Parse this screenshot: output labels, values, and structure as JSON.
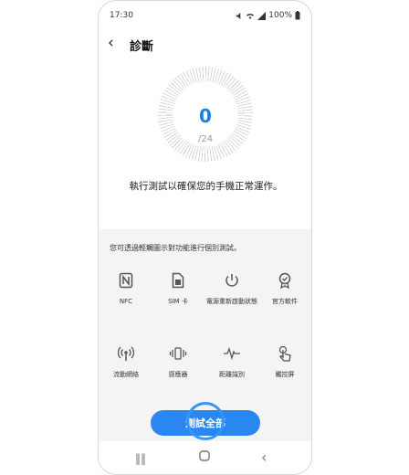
{
  "status": {
    "time": "17:30",
    "battery": "100%"
  },
  "header": {
    "title": "診斷"
  },
  "dial": {
    "score": "0",
    "total": "/24"
  },
  "description": "執行測試以確保您的手機正常運作。",
  "hint": "您可透過輕觸圖示對功能進行個別測試。",
  "items": [
    {
      "label": "NFC",
      "icon": "nfc-icon"
    },
    {
      "label": "SIM 卡",
      "icon": "sim-icon"
    },
    {
      "label": "電源重新啟動狀態",
      "icon": "power-icon"
    },
    {
      "label": "官方軟件",
      "icon": "badge-icon"
    },
    {
      "label": "流動網絡",
      "icon": "antenna-icon"
    },
    {
      "label": "感應器",
      "icon": "vibration-icon"
    },
    {
      "label": "距離識別",
      "icon": "pulse-icon"
    },
    {
      "label": "觸控屏",
      "icon": "touch-icon"
    }
  ],
  "button": {
    "label": "測試全部"
  },
  "colors": {
    "accent": "#2a86f0",
    "score": "#1f7ee0"
  }
}
